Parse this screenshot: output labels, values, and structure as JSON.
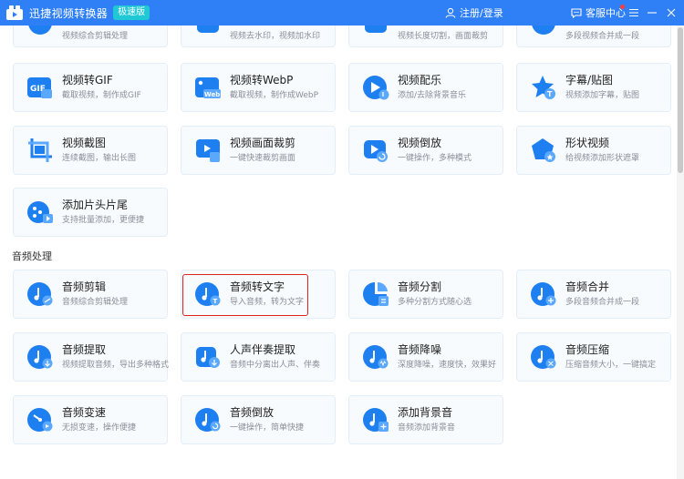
{
  "app": {
    "title": "迅捷视频转换器",
    "badge": "极速版",
    "login": "注册/登录",
    "service": "客服中心"
  },
  "colors": {
    "titlebar": "#2f7ff7",
    "badge": "#1ec8d4",
    "icon_blue": "#1e7ff0",
    "highlight": "#e0231a"
  },
  "video_cards_top": [
    {
      "subtitle": "视频综合剪辑处理"
    },
    {
      "subtitle": "视频去水印，视频加水印"
    },
    {
      "subtitle": "视频长度切割，画面裁剪"
    },
    {
      "subtitle": "多段视频合并成一段"
    }
  ],
  "video_cards": [
    {
      "title": "视频转GIF",
      "subtitle": "截取视频，制作成GIF",
      "icon": "gif-icon"
    },
    {
      "title": "视频转WebP",
      "subtitle": "截取视频，制作成WebP",
      "icon": "webp-icon"
    },
    {
      "title": "视频配乐",
      "subtitle": "添加/去除背景音乐",
      "icon": "music-icon"
    },
    {
      "title": "字幕/贴图",
      "subtitle": "视频添加字幕，贴图",
      "icon": "star-sticker-icon"
    },
    {
      "title": "视频截图",
      "subtitle": "连续截图，输出长图",
      "icon": "screenshot-icon"
    },
    {
      "title": "视频画面裁剪",
      "subtitle": "一键快速裁剪画面",
      "icon": "crop-icon"
    },
    {
      "title": "视频倒放",
      "subtitle": "一键操作，多种模式",
      "icon": "reverse-icon"
    },
    {
      "title": "形状视频",
      "subtitle": "给视频添加形状遮罩",
      "icon": "shape-icon"
    },
    {
      "title": "添加片头片尾",
      "subtitle": "支持批量添加，更便捷",
      "icon": "intro-outro-icon"
    }
  ],
  "audio_section": {
    "title": "音频处理"
  },
  "audio_cards": [
    {
      "title": "音频剪辑",
      "subtitle": "音频综合剪辑处理",
      "icon": "audio-edit-icon"
    },
    {
      "title": "音频转文字",
      "subtitle": "导入音频，转为文字",
      "icon": "audio-to-text-icon"
    },
    {
      "title": "音频分割",
      "subtitle": "多种分割方式随心选",
      "icon": "audio-split-icon"
    },
    {
      "title": "音频合并",
      "subtitle": "多段音频合并成一段",
      "icon": "audio-merge-icon"
    },
    {
      "title": "音频提取",
      "subtitle": "视频提取音频，导出多种格式",
      "icon": "audio-extract-icon"
    },
    {
      "title": "人声伴奏提取",
      "subtitle": "音频中分离出人声、伴奏",
      "icon": "vocal-extract-icon"
    },
    {
      "title": "音频降噪",
      "subtitle": "深度降噪，速度快，效果好",
      "icon": "denoise-icon"
    },
    {
      "title": "音频压缩",
      "subtitle": "压缩音频大小，一键搞定",
      "icon": "audio-compress-icon"
    },
    {
      "title": "音频变速",
      "subtitle": "无损变速，操作便捷",
      "icon": "audio-speed-icon"
    },
    {
      "title": "音频倒放",
      "subtitle": "一键操作，简单快捷",
      "icon": "audio-reverse-icon"
    },
    {
      "title": "添加背景音",
      "subtitle": "音频添加背景音",
      "icon": "add-bgm-icon"
    }
  ]
}
